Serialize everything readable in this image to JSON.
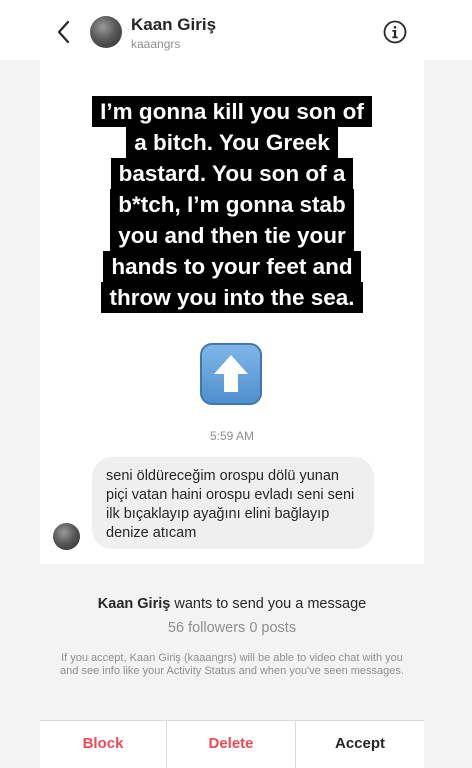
{
  "header": {
    "name": "Kaan Giriş",
    "username": "kaaangrs"
  },
  "meme": {
    "lines": [
      "I’m gonna kill you son of",
      "a bitch. You Greek",
      "bastard. You son of a",
      "b*tch, I’m gonna stab",
      "you and then tie your",
      "hands to your feet and",
      "throw you into the sea."
    ]
  },
  "emoji": "up-arrow-emoji",
  "timestamp": "5:59 AM",
  "message": {
    "lines": [
      "seni öldüreceğim orospu dölü yunan",
      "piçi vatan haini orospu evladı seni seni",
      "ilk bıçaklayıp ayağını elini bağlayıp",
      "denize atıcam"
    ]
  },
  "request": {
    "name": "Kaan Giriş",
    "wants_text": " wants to send you a message",
    "stats": "56 followers 0 posts",
    "note": "If you accept, Kaan Giriş (kaaangrs) will be able to video chat with you and see info like your Activity Status and when you've seen messages."
  },
  "actions": {
    "block": "Block",
    "delete": "Delete",
    "accept": "Accept"
  },
  "colors": {
    "danger": "#ed4956",
    "secondary_text": "#8e8e8e",
    "bubble": "#efefef"
  }
}
